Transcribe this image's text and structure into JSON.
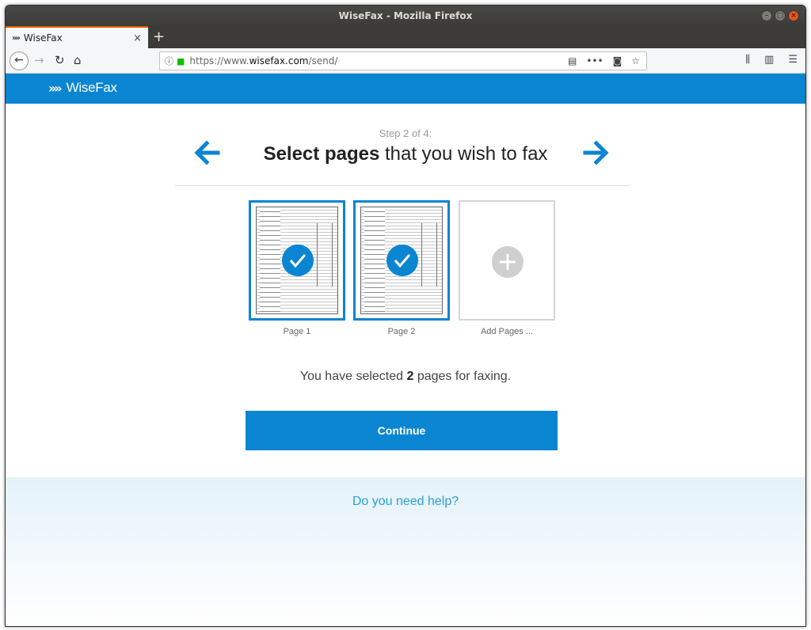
{
  "browser": {
    "window_title": "WiseFax - Mozilla Firefox",
    "tab_title": "WiseFax",
    "url_prefix": "https://www.",
    "url_domain": "wisefax.com",
    "url_path": "/send/"
  },
  "site": {
    "logo_text": "WiseFax",
    "brand_color": "#0a85d1"
  },
  "wizard": {
    "step": "Step 2 of 4:",
    "heading_bold": "Select pages",
    "heading_rest": " that you wish to fax"
  },
  "pages": [
    {
      "label": "Page 1",
      "selected": true
    },
    {
      "label": "Page 2",
      "selected": true
    },
    {
      "label": "Add Pages ...",
      "selected": false
    }
  ],
  "summary": {
    "prefix": "You have selected ",
    "count": "2",
    "suffix": " pages for faxing."
  },
  "continue_label": "Continue",
  "help_link": "Do you need help?"
}
